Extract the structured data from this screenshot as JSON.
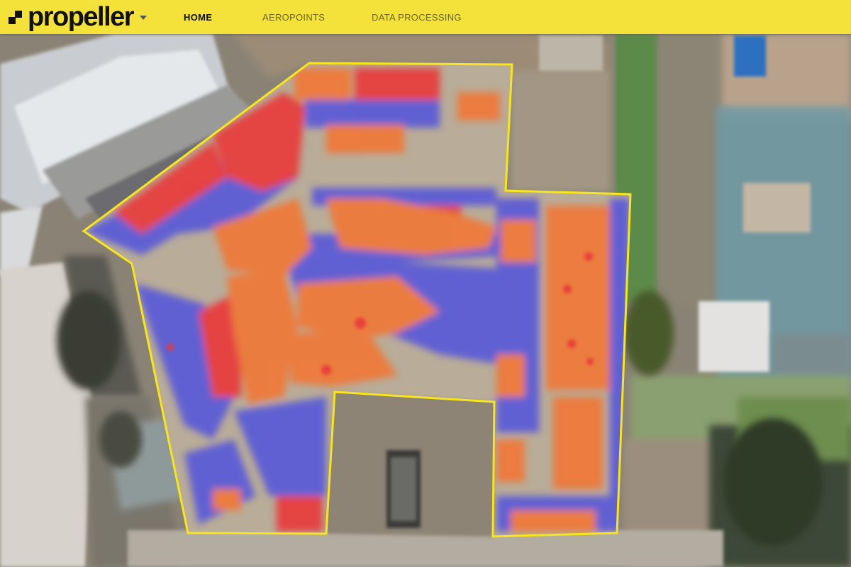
{
  "app": {
    "logo_text": "propeller"
  },
  "nav": {
    "items": [
      {
        "label": "HOME",
        "active": true
      },
      {
        "label": "AEROPOINTS",
        "active": false
      },
      {
        "label": "DATA PROCESSING",
        "active": false
      }
    ]
  },
  "map": {
    "view": "aerial site survey with cut/fill heatmap overlay",
    "colors": {
      "boundary": "#f7e51e",
      "cut_red": "#e83a3a",
      "fill_orange": "#f07838",
      "neutral_blue": "#5a5ad8",
      "toolbar_yellow": "#f4e23b"
    }
  }
}
